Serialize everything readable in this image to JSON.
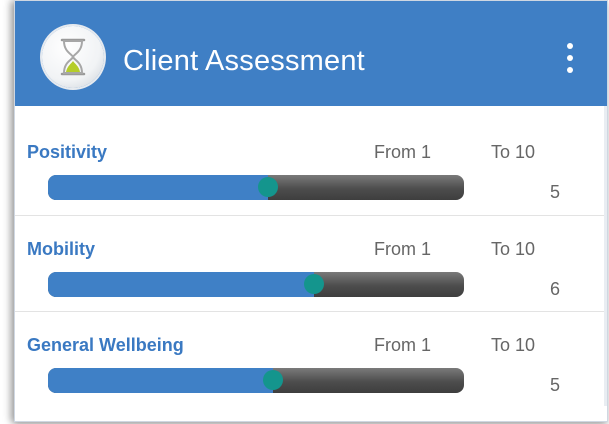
{
  "app": {
    "title": "Client Assessment",
    "logo_icon": "hourglass-icon",
    "menu_icon": "more-vert-icon",
    "bar_color": "#3f7fc5"
  },
  "sliders": [
    {
      "label": "Positivity",
      "from_label": "From 1",
      "to_label": "To 10",
      "min": 1,
      "max": 10,
      "value": "5",
      "fraction": 0.53
    },
    {
      "label": "Mobility",
      "from_label": "From 1",
      "to_label": "To 10",
      "min": 1,
      "max": 10,
      "value": "6",
      "fraction": 0.64
    },
    {
      "label": "General Wellbeing",
      "from_label": "From 1",
      "to_label": "To 10",
      "min": 1,
      "max": 10,
      "value": "5",
      "fraction": 0.54
    }
  ],
  "colors": {
    "fill": "#3f80c6",
    "thumb": "#14958d",
    "track": "#4d4d4d",
    "label": "#3a79c2"
  }
}
